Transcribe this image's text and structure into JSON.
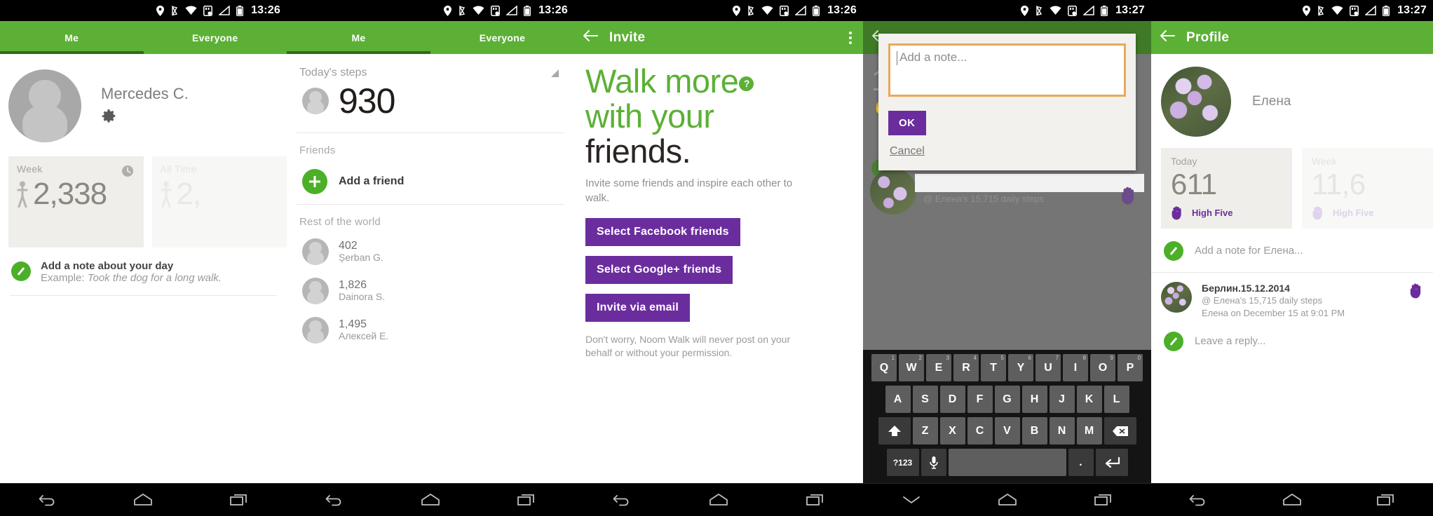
{
  "panels": [
    {
      "status": {
        "time": "13:26"
      },
      "tabs": [
        {
          "label": "Me",
          "active": true
        },
        {
          "label": "Everyone",
          "active": false
        }
      ],
      "profile": {
        "name": "Mercedes C."
      },
      "cards": [
        {
          "label": "Week",
          "value": "2,338"
        },
        {
          "label": "All Time",
          "value": "2,"
        }
      ],
      "note": {
        "title": "Add a note about your day",
        "example_prefix": "Example: ",
        "example_italic": "Took the dog for a long walk."
      }
    },
    {
      "status": {
        "time": "13:26"
      },
      "tabs": [
        {
          "label": "Me",
          "active": true
        },
        {
          "label": "Everyone",
          "active": false
        }
      ],
      "today": {
        "label": "Today's steps",
        "value": "930"
      },
      "friends": {
        "label": "Friends",
        "add_label": "Add a friend"
      },
      "world": {
        "label": "Rest of the world",
        "people": [
          {
            "steps": "402",
            "name": "Șerban G."
          },
          {
            "steps": "1,826",
            "name": "Dainora S."
          },
          {
            "steps": "1,495",
            "name": "Алексей Е."
          }
        ]
      }
    },
    {
      "status": {
        "time": "13:26"
      },
      "actionbar": {
        "title": "Invite"
      },
      "hero": {
        "line1": "Walk more",
        "line2": "with your",
        "line3": "friends.",
        "badge": "?"
      },
      "subtitle": "Invite some friends and inspire each other to walk.",
      "buttons": [
        "Select Facebook friends",
        "Select Google+ friends",
        "Invite via email"
      ],
      "fineprint": "Don't worry, Noom Walk will never post on your behalf or without your permission."
    },
    {
      "status": {
        "time": "13:27"
      },
      "dialog": {
        "placeholder": "Add a note...",
        "ok_label": "OK",
        "cancel_label": "Cancel"
      },
      "background": {
        "step_caption": "@ Елена's 15,715 daily steps"
      },
      "keyboard": {
        "row1": [
          {
            "key": "Q",
            "hint": "1"
          },
          {
            "key": "W",
            "hint": "2"
          },
          {
            "key": "E",
            "hint": "3"
          },
          {
            "key": "R",
            "hint": "4"
          },
          {
            "key": "T",
            "hint": "5"
          },
          {
            "key": "Y",
            "hint": "6"
          },
          {
            "key": "U",
            "hint": "7"
          },
          {
            "key": "I",
            "hint": "8"
          },
          {
            "key": "O",
            "hint": "9"
          },
          {
            "key": "P",
            "hint": "0"
          }
        ],
        "row2": [
          "A",
          "S",
          "D",
          "F",
          "G",
          "H",
          "J",
          "K",
          "L"
        ],
        "row3": [
          "Z",
          "X",
          "C",
          "V",
          "B",
          "N",
          "M"
        ],
        "symbols_key": "?123",
        "period_key": "."
      }
    },
    {
      "status": {
        "time": "13:27"
      },
      "actionbar": {
        "title": "Profile"
      },
      "profile": {
        "name": "Елена"
      },
      "cards": [
        {
          "label": "Today",
          "value": "611",
          "high_five": "High Five"
        },
        {
          "label": "Week",
          "value": "11,6",
          "high_five": "High Five"
        }
      ],
      "add_note": "Add a note for Елена...",
      "post": {
        "title": "Берлин.15.12.2014",
        "meta_line1": "@ Елена's 15,715 daily steps",
        "meta_line2": "Елена on December 15 at 9:01 PM"
      },
      "reply": "Leave a reply..."
    }
  ],
  "colors": {
    "green": "#5cb036",
    "green_dark": "#2f6b1c",
    "purple": "#6b2d9e",
    "badge_green": "#4caf28",
    "orange_border": "#e8a85a"
  }
}
